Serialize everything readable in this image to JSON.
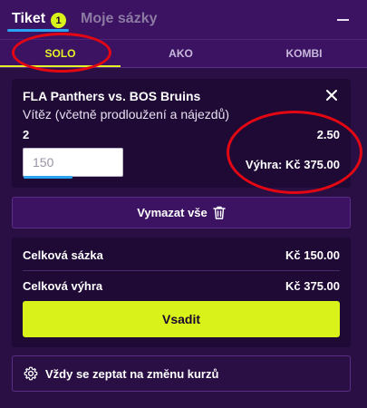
{
  "header": {
    "tabs": [
      {
        "label": "Tiket",
        "badge": "1",
        "active": true
      },
      {
        "label": "Moje sázky",
        "active": false
      }
    ],
    "collapse_icon": "minus-icon"
  },
  "bet_type_tabs": [
    {
      "label": "SOLO",
      "active": true
    },
    {
      "label": "AKO",
      "active": false
    },
    {
      "label": "KOMBI",
      "active": false
    }
  ],
  "bet": {
    "match": "FLA Panthers vs. BOS Bruins",
    "market": "Vítěz (včetně prodloužení a nájezdů)",
    "selection": "2",
    "odds": "2.50",
    "stake_placeholder": "150",
    "winnings": "Výhra: Kč 375.00",
    "remove_icon": "close-icon"
  },
  "clear_all": {
    "label": "Vymazat vše",
    "icon": "trash-icon"
  },
  "summary": {
    "total_stake_label": "Celková sázka",
    "total_stake_value": "Kč 150.00",
    "total_win_label": "Celková výhra",
    "total_win_value": "Kč 375.00",
    "place_bet_label": "Vsadit"
  },
  "odds_change": {
    "label": "Vždy se zeptat na změnu kurzů",
    "icon": "gear-icon"
  },
  "colors": {
    "background": "#2a0f45",
    "accent": "#d9f21a",
    "annotation": "#e30613",
    "underline": "#2aa3f0"
  }
}
